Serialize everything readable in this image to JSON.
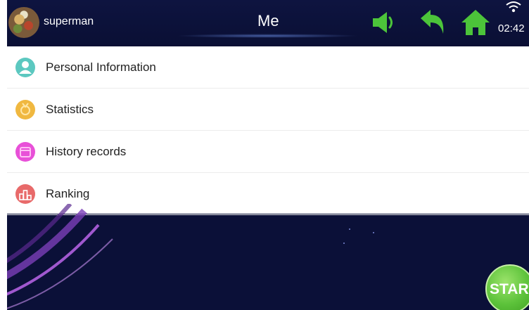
{
  "header": {
    "username": "superman",
    "title": "Me",
    "time": "02:42",
    "icons": [
      "avatar",
      "speaker-icon",
      "back-icon",
      "home-icon",
      "wifi-icon"
    ]
  },
  "menu": {
    "items": [
      {
        "label": "Personal Information",
        "icon": "person-icon",
        "color": "#5cc8c0"
      },
      {
        "label": "Statistics",
        "icon": "medal-icon",
        "color": "#f0b840"
      },
      {
        "label": "History records",
        "icon": "calendar-icon",
        "color": "#e850d8"
      },
      {
        "label": "Ranking",
        "icon": "ranking-icon",
        "color": "#e86a6a"
      }
    ]
  },
  "start_button": {
    "label": "START",
    "color": "#5cc23a"
  },
  "colors": {
    "background": "#0b1038",
    "accent_green": "#4cc43a",
    "menu_bg": "#ffffff"
  }
}
